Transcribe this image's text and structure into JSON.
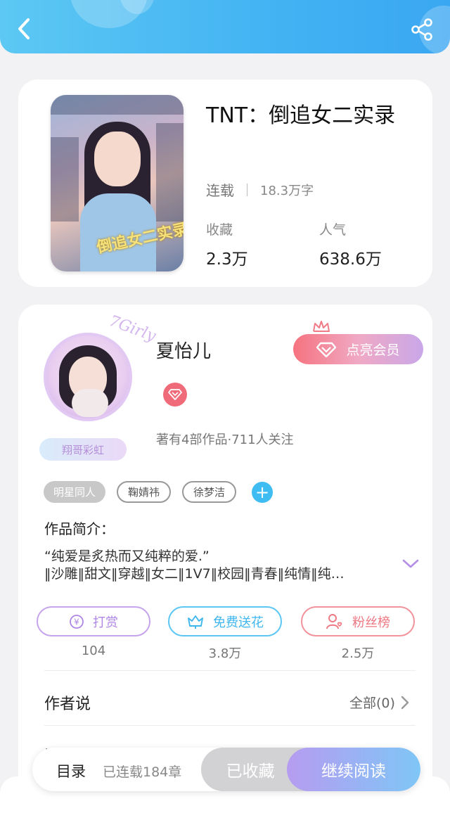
{
  "header": {
    "back_icon": "back-arrow-icon",
    "share_icon": "share-icon"
  },
  "book": {
    "cover_text": "倒追女二实录",
    "title": "TNT：倒追女二实录",
    "status": "连载",
    "word_count": "18.3万字",
    "favorites_label": "收藏",
    "favorites_value": "2.3万",
    "popularity_label": "人气",
    "popularity_value": "638.6万"
  },
  "author": {
    "avatar_deco": "7Girly",
    "fan_badge": "翔哥彩虹",
    "name": "夏怡儿",
    "vip_button": "点亮会员",
    "meta": "著有4部作品·711人关注",
    "tags": [
      "明星同人",
      "鞠婧祎",
      "徐梦洁"
    ],
    "intro_label": "作品简介：",
    "intro_line1": "“纯爱是炙热而又纯粹的爱.”",
    "intro_line2": "‖沙雕‖甜文‖穿越‖女二‖1V7‖校园‖青春‖纯情‖纯…"
  },
  "actions": {
    "tip": {
      "label": "打赏",
      "count": "104"
    },
    "flower": {
      "label": "免费送花",
      "count": "3.8万"
    },
    "fans": {
      "label": "粉丝榜",
      "count": "2.5万"
    }
  },
  "author_says": {
    "label": "作者说",
    "all_link": "全部(0)",
    "next_section_cut": "评论"
  },
  "bottom": {
    "toc": "目录",
    "chapters": "已连载184章",
    "collected": "已收藏",
    "continue": "继续阅读"
  },
  "colors": {
    "accent_blue": "#43b3f3",
    "accent_purple": "#b086e6",
    "accent_pink": "#ee7782"
  }
}
